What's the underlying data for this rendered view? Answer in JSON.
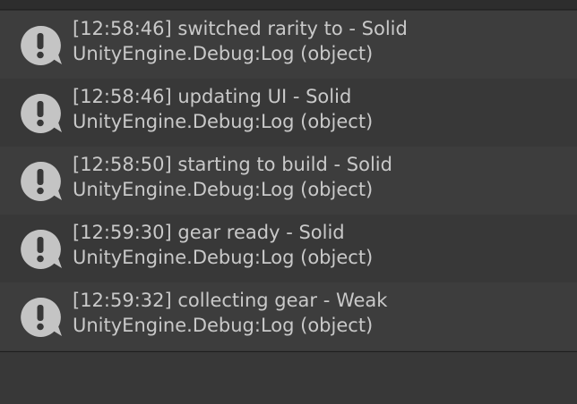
{
  "console": {
    "entries": [
      {
        "message": "[12:58:46] switched rarity to - Solid",
        "trace": "UnityEngine.Debug:Log (object)",
        "icon": "info-speech-bubble-icon"
      },
      {
        "message": "[12:58:46] updating UI - Solid",
        "trace": "UnityEngine.Debug:Log (object)",
        "icon": "info-speech-bubble-icon"
      },
      {
        "message": "[12:58:50] starting to build - Solid",
        "trace": "UnityEngine.Debug:Log (object)",
        "icon": "info-speech-bubble-icon"
      },
      {
        "message": "[12:59:30] gear ready - Solid",
        "trace": "UnityEngine.Debug:Log (object)",
        "icon": "info-speech-bubble-icon"
      },
      {
        "message": "[12:59:32] collecting gear - Weak",
        "trace": "UnityEngine.Debug:Log (object)",
        "icon": "info-speech-bubble-icon"
      }
    ]
  },
  "colors": {
    "background": "#383838",
    "row_alt": "#3d3d3d",
    "text": "#c9c9c9",
    "icon": "#c4c4c4"
  }
}
